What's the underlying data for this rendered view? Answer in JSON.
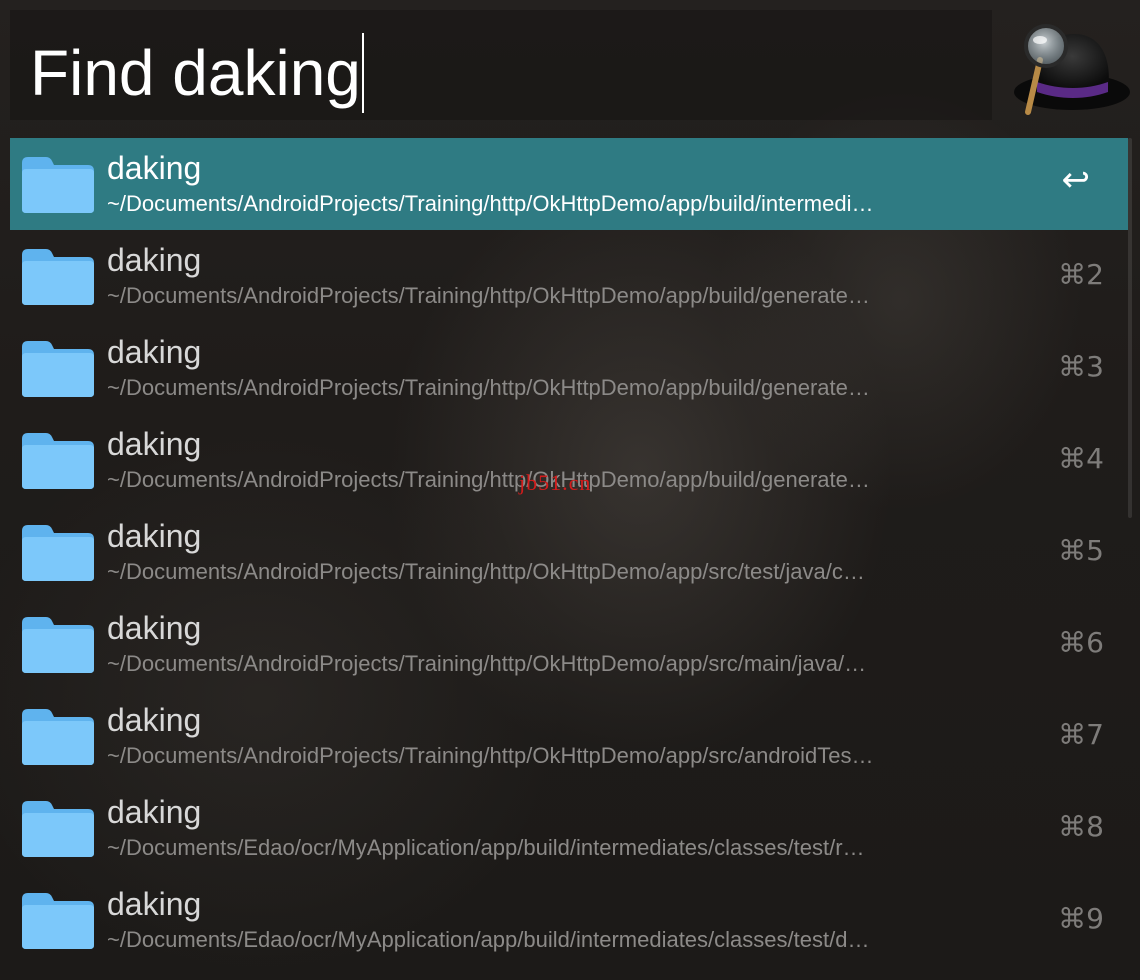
{
  "search": {
    "query": "Find daking"
  },
  "results": [
    {
      "title": "daking",
      "path": "~/Documents/AndroidProjects/Training/http/OkHttpDemo/app/build/intermedi…",
      "shortcut": "↩",
      "selected": true
    },
    {
      "title": "daking",
      "path": "~/Documents/AndroidProjects/Training/http/OkHttpDemo/app/build/generate…",
      "shortcut": "⌘2",
      "selected": false
    },
    {
      "title": "daking",
      "path": "~/Documents/AndroidProjects/Training/http/OkHttpDemo/app/build/generate…",
      "shortcut": "⌘3",
      "selected": false
    },
    {
      "title": "daking",
      "path": "~/Documents/AndroidProjects/Training/http/OkHttpDemo/app/build/generate…",
      "shortcut": "⌘4",
      "selected": false
    },
    {
      "title": "daking",
      "path": "~/Documents/AndroidProjects/Training/http/OkHttpDemo/app/src/test/java/c…",
      "shortcut": "⌘5",
      "selected": false
    },
    {
      "title": "daking",
      "path": "~/Documents/AndroidProjects/Training/http/OkHttpDemo/app/src/main/java/…",
      "shortcut": "⌘6",
      "selected": false
    },
    {
      "title": "daking",
      "path": "~/Documents/AndroidProjects/Training/http/OkHttpDemo/app/src/androidTes…",
      "shortcut": "⌘7",
      "selected": false
    },
    {
      "title": "daking",
      "path": "~/Documents/Edao/ocr/MyApplication/app/build/intermediates/classes/test/r…",
      "shortcut": "⌘8",
      "selected": false
    },
    {
      "title": "daking",
      "path": "~/Documents/Edao/ocr/MyApplication/app/build/intermediates/classes/test/d…",
      "shortcut": "⌘9",
      "selected": false
    }
  ],
  "watermark": "jb51.cn",
  "icons": {
    "logo": "alfred-hat-icon",
    "result": "folder-icon"
  },
  "colors": {
    "selection": "#2f7b83",
    "folder": "#6ec1f7"
  }
}
